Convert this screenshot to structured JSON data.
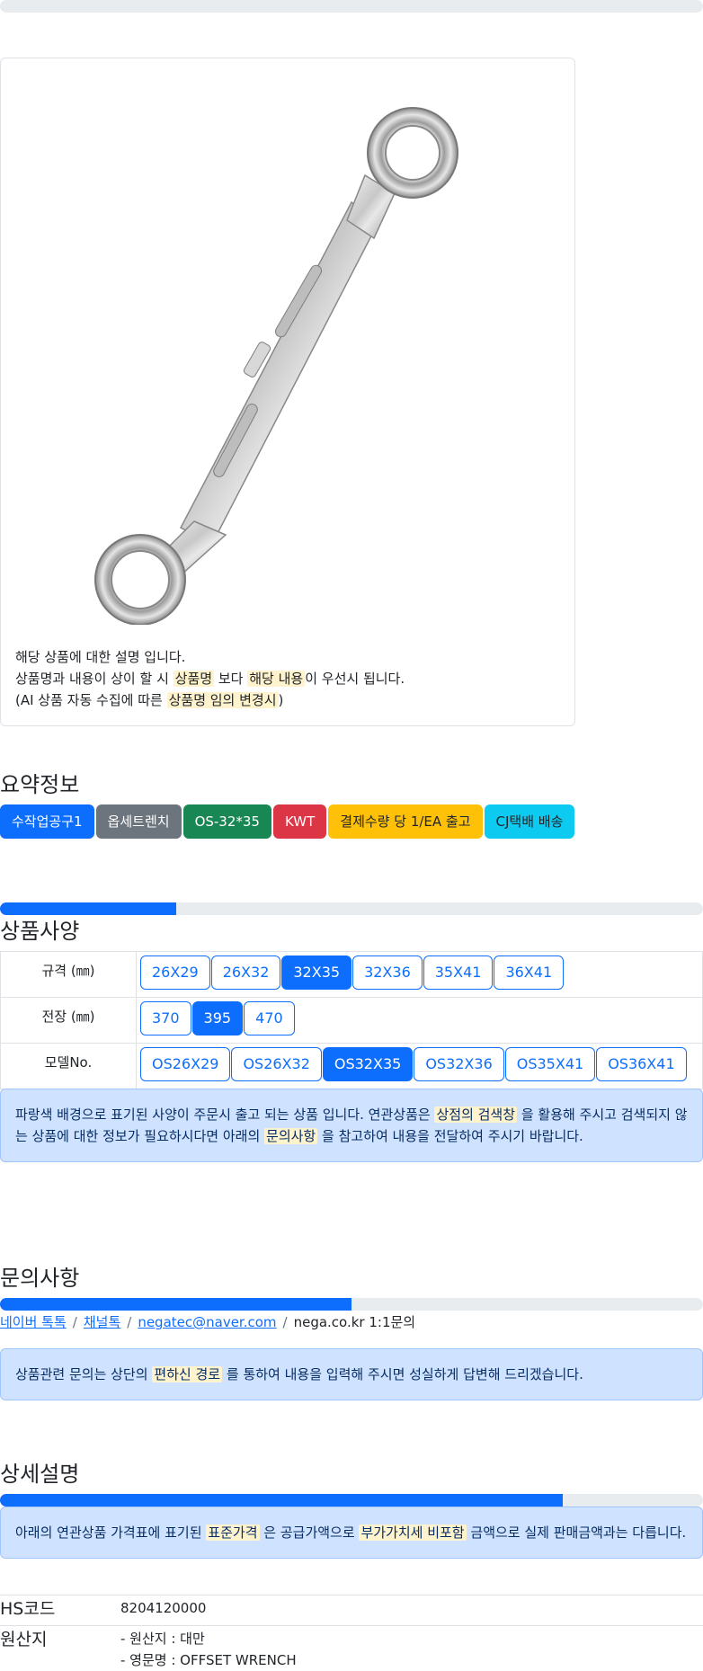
{
  "product": {
    "description_line1": "해당 상품에 대한 설명 입니다.",
    "description_line2": {
      "a": "상품명과 내용이 상이 할 시",
      "hl1": "상품명",
      "b": "보다",
      "hl2": "해당 내용",
      "c": "이 우선시 됩니다."
    },
    "description_line3": {
      "a": "(AI 상품 자동 수집에 따른",
      "hl": "상품명 임의 변경시",
      "b": ")"
    }
  },
  "summary": {
    "title": "요약정보",
    "badges": [
      "수작업공구1",
      "옵세트렌치",
      "OS-32*35",
      "KWT",
      "결제수량 당 1/EA 출고",
      "CJ택배 배송"
    ]
  },
  "specs": {
    "title": "상품사양",
    "progress_percent": 25,
    "rows": [
      {
        "label": "규격 (㎜)",
        "options": [
          "26X29",
          "26X32",
          "32X35",
          "32X36",
          "35X41",
          "36X41"
        ],
        "selected": "32X35"
      },
      {
        "label": "전장 (㎜)",
        "options": [
          "370",
          "395",
          "470"
        ],
        "selected": "395"
      },
      {
        "label": "모델No.",
        "options": [
          "OS26X29",
          "OS26X32",
          "OS32X35",
          "OS32X36",
          "OS35X41",
          "OS36X41"
        ],
        "selected": "OS32X35"
      }
    ],
    "notice": {
      "a": "파랑색 배경으로 표기된 사양이 주문시 출고 되는 상품 입니다. 연관상품은",
      "hl1": "상점의 검색창",
      "b": "을 활용해 주시고 검색되지 않는 상품에 대한 정보가 필요하시다면 아래의",
      "hl2": "문의사항",
      "c": "을 참고하여 내용을 전달하여 주시기 바랍니다."
    }
  },
  "inquiry": {
    "title": "문의사항",
    "progress_percent": 50,
    "links": [
      "네이버 톡톡",
      "채널톡",
      "negatec@naver.com"
    ],
    "plain": "nega.co.kr 1:1문의",
    "notice": {
      "a": "상품관련 문의는 상단의",
      "hl": "편하신 경로",
      "b": "를 통하여 내용을 입력해 주시면 성실하게 답변해 드리겠습니다."
    }
  },
  "detail": {
    "title": "상세설명",
    "progress_percent": 80,
    "notice": {
      "a": "아래의 연관상품 가격표에 표기된",
      "hl1": "표준가격",
      "b": "은 공급가액으로",
      "hl2": "부가가치세 비포함",
      "c": "금액으로 실제 판매금액과는 다릅니다."
    },
    "hs_label": "HS코드",
    "hs_value": "8204120000",
    "origin_label": "원산지",
    "origin_line1": "- 원산지 : 대만",
    "origin_line2": "- 영문명 : OFFSET WRENCH"
  },
  "colors": {
    "primary": "#0d6efd",
    "highlight": "#fff3cd",
    "alert_bg": "#cfe2ff"
  }
}
